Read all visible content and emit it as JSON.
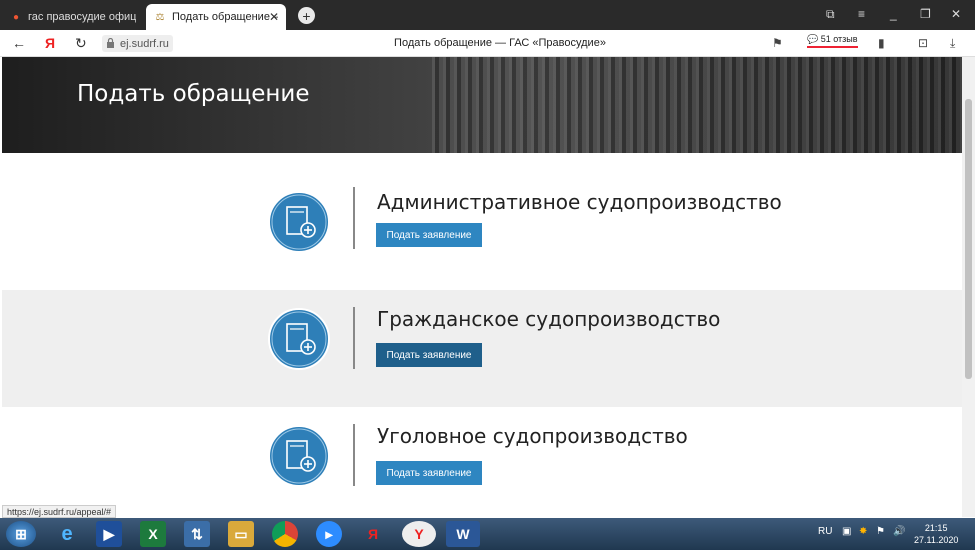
{
  "browser": {
    "tabs": [
      {
        "label": "гас правосудие официаль",
        "active": false
      },
      {
        "label": "Подать обращение — ",
        "active": true
      }
    ],
    "url": "ej.sudrf.ru",
    "page_title": "Подать обращение — ГАС «Правосудие»",
    "reviews": "51 отзыв",
    "yandex_label": "Я",
    "status_url": "https://ej.sudrf.ru/appeal/#"
  },
  "page": {
    "hero_title": "Подать обращение",
    "sections": [
      {
        "title": "Административное судопроизводство",
        "button": "Подать заявление"
      },
      {
        "title": "Гражданское судопроизводство",
        "button": "Подать заявление"
      },
      {
        "title": "Уголовное судопроизводство",
        "button": "Подать заявление"
      }
    ]
  },
  "taskbar": {
    "lang": "RU",
    "time": "21:15",
    "date": "27.11.2020",
    "yandex_label": "Я"
  },
  "colors": {
    "accent": "#2e86c1",
    "accent_dark": "#1f5f8b",
    "icon_blue": "#2e7fb8"
  }
}
